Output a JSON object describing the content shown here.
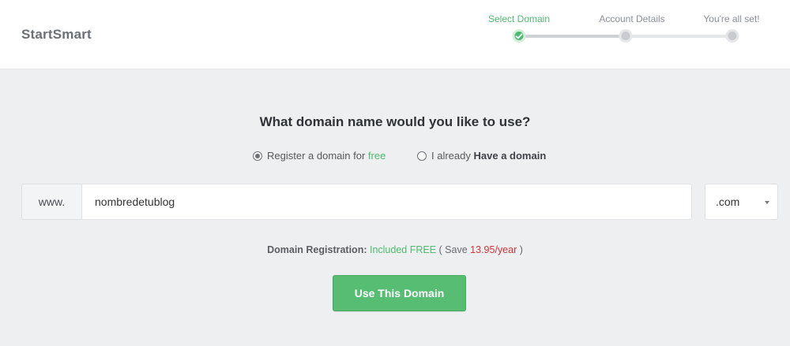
{
  "app": {
    "name": "StartSmart"
  },
  "stepper": {
    "steps": [
      {
        "label": "Select Domain",
        "state": "active"
      },
      {
        "label": "Account Details",
        "state": "pending"
      },
      {
        "label": "You're all set!",
        "state": "pending"
      }
    ]
  },
  "page": {
    "title": "What domain name would you like to use?"
  },
  "options": {
    "register": {
      "text": "Register a domain for ",
      "highlight": "free",
      "checked": true
    },
    "existing": {
      "text": "I already ",
      "highlight": "Have a domain",
      "checked": false
    }
  },
  "domain": {
    "prefix": "www.",
    "value": "nombredetublog",
    "tld": ".com"
  },
  "registration": {
    "label": "Domain Registration:",
    "included": "Included FREE",
    "save_open": "( Save",
    "price": "13.95/year",
    "save_close": ")"
  },
  "actions": {
    "use_domain": "Use This Domain"
  },
  "colors": {
    "accent": "#4fba6f",
    "button": "#57bd72",
    "price": "#d0343a",
    "background": "#eeeff0"
  }
}
